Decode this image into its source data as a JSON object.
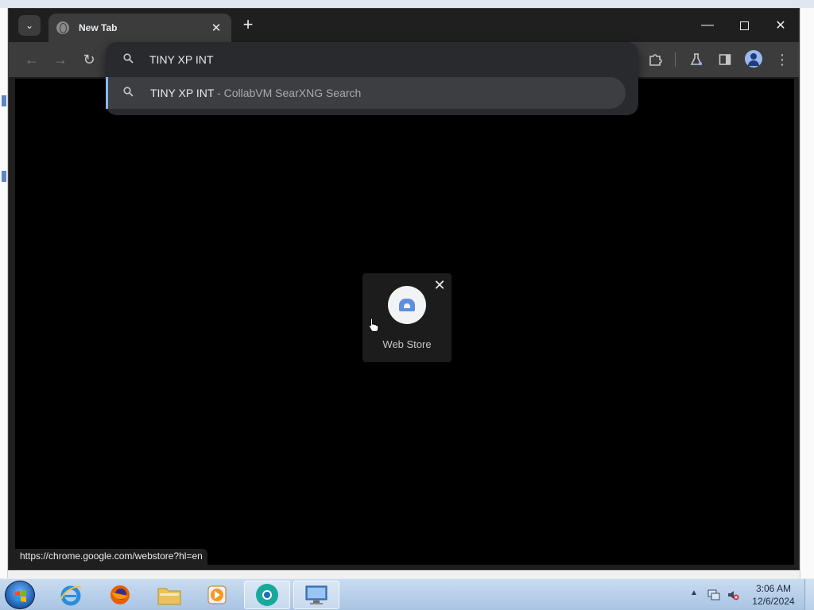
{
  "tab": {
    "title": "New Tab"
  },
  "omnibox": {
    "value": "TINY XP INT",
    "suggestion": {
      "query": "TINY XP INT",
      "separator": " - ",
      "description": "CollabVM SearXNG Search"
    }
  },
  "shortcut_tile": {
    "label": "Web Store"
  },
  "status_url": "https://chrome.google.com/webstore?hl=en",
  "clock": {
    "time": "3:06 AM",
    "date": "12/6/2024"
  },
  "icons": {
    "tab_search": "chevron-down-icon",
    "tab_favicon": "globe-icon",
    "back": "arrow-left-icon",
    "forward": "arrow-right-icon",
    "reload": "reload-icon",
    "search": "search-icon",
    "extensions": "puzzle-icon",
    "labs": "flask-icon",
    "side_panel": "side-panel-icon",
    "profile": "avatar-icon",
    "menu": "kebab-menu-icon"
  },
  "colors": {
    "accent": "#8ab4f8",
    "page_bg": "#000000",
    "toolbar": "#3c3c3c"
  }
}
